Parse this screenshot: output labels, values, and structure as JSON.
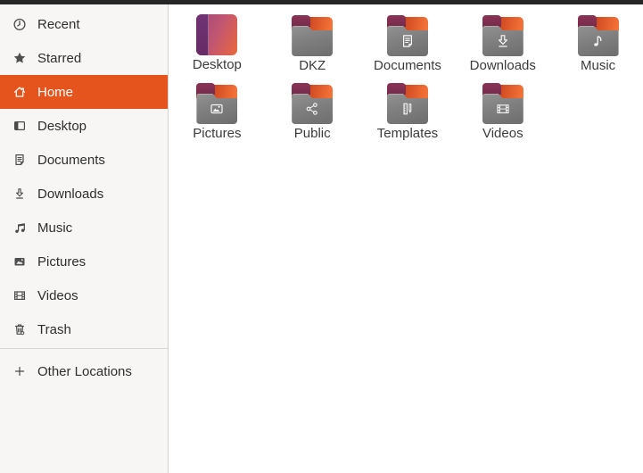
{
  "window": {
    "app": "Files",
    "topbar_color": "#262626"
  },
  "colors": {
    "accent_orange": "#E4541C",
    "sidebar_bg": "#f7f6f5",
    "main_bg": "#ffffff",
    "folder_tab_maroon": "#7c2c4e",
    "folder_back_orange": "#ED6432",
    "folder_gray": "#7f7f7f",
    "desktop_purple": "#6d2f6e",
    "desktop_orange": "#e9683c",
    "sidebar_icon_gray": "#4a4a4a",
    "text_dark": "#2e2e2e"
  },
  "sidebar": {
    "items": [
      {
        "label": "Recent",
        "icon": "clock-icon",
        "selected": false
      },
      {
        "label": "Starred",
        "icon": "star-icon",
        "selected": false
      },
      {
        "label": "Home",
        "icon": "home-icon",
        "selected": true
      },
      {
        "label": "Desktop",
        "icon": "window-icon",
        "selected": false
      },
      {
        "label": "Documents",
        "icon": "document-icon",
        "selected": false
      },
      {
        "label": "Downloads",
        "icon": "download-icon",
        "selected": false
      },
      {
        "label": "Music",
        "icon": "music-note-icon",
        "selected": false
      },
      {
        "label": "Pictures",
        "icon": "image-icon",
        "selected": false
      },
      {
        "label": "Videos",
        "icon": "film-icon",
        "selected": false
      },
      {
        "label": "Trash",
        "icon": "trash-icon",
        "selected": false
      },
      {
        "label": "Other Locations",
        "icon": "plus-icon",
        "selected": false
      }
    ]
  },
  "main": {
    "items": [
      {
        "label": "Desktop",
        "icon": "user-desktop-icon",
        "emblem": "none"
      },
      {
        "label": "DKZ",
        "icon": "folder-icon",
        "emblem": "none"
      },
      {
        "label": "Documents",
        "icon": "folder-icon",
        "emblem": "document-emblem"
      },
      {
        "label": "Downloads",
        "icon": "folder-icon",
        "emblem": "download-arrow-emblem"
      },
      {
        "label": "Music",
        "icon": "folder-icon",
        "emblem": "music-note-emblem"
      },
      {
        "label": "Pictures",
        "icon": "folder-icon",
        "emblem": "photo-emblem"
      },
      {
        "label": "Public",
        "icon": "folder-icon",
        "emblem": "share-emblem"
      },
      {
        "label": "Templates",
        "icon": "folder-icon",
        "emblem": "ruler-pencil-emblem"
      },
      {
        "label": "Videos",
        "icon": "folder-icon",
        "emblem": "film-emblem"
      }
    ]
  }
}
